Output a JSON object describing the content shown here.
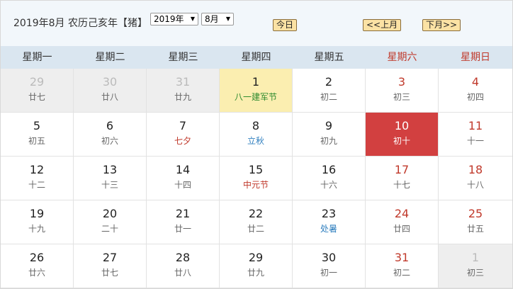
{
  "header": {
    "title": "2019年8月 农历己亥年【猪】",
    "year_select": "2019年",
    "month_select": "8月",
    "today_button": "今日",
    "prev_button": "<<上月",
    "next_button": "下月>>"
  },
  "weekdays": [
    "星期一",
    "星期二",
    "星期三",
    "星期四",
    "星期五",
    "星期六",
    "星期日"
  ],
  "weeks": [
    [
      {
        "day": "29",
        "lunar": "廿七",
        "type": "other"
      },
      {
        "day": "30",
        "lunar": "廿八",
        "type": "other"
      },
      {
        "day": "31",
        "lunar": "廿九",
        "type": "other"
      },
      {
        "day": "1",
        "lunar": "八一建军节",
        "type": "today"
      },
      {
        "day": "2",
        "lunar": "初二",
        "type": "normal"
      },
      {
        "day": "3",
        "lunar": "初三",
        "type": "weekend"
      },
      {
        "day": "4",
        "lunar": "初四",
        "type": "weekend"
      }
    ],
    [
      {
        "day": "5",
        "lunar": "初五",
        "type": "normal"
      },
      {
        "day": "6",
        "lunar": "初六",
        "type": "normal"
      },
      {
        "day": "7",
        "lunar": "七夕",
        "type": "normal",
        "lunar_style": "festival"
      },
      {
        "day": "8",
        "lunar": "立秋",
        "type": "normal",
        "lunar_style": "term"
      },
      {
        "day": "9",
        "lunar": "初九",
        "type": "normal"
      },
      {
        "day": "10",
        "lunar": "初十",
        "type": "selected"
      },
      {
        "day": "11",
        "lunar": "十一",
        "type": "weekend"
      }
    ],
    [
      {
        "day": "12",
        "lunar": "十二",
        "type": "normal"
      },
      {
        "day": "13",
        "lunar": "十三",
        "type": "normal"
      },
      {
        "day": "14",
        "lunar": "十四",
        "type": "normal"
      },
      {
        "day": "15",
        "lunar": "中元节",
        "type": "normal",
        "lunar_style": "festival"
      },
      {
        "day": "16",
        "lunar": "十六",
        "type": "normal"
      },
      {
        "day": "17",
        "lunar": "十七",
        "type": "weekend"
      },
      {
        "day": "18",
        "lunar": "十八",
        "type": "weekend"
      }
    ],
    [
      {
        "day": "19",
        "lunar": "十九",
        "type": "normal"
      },
      {
        "day": "20",
        "lunar": "二十",
        "type": "normal"
      },
      {
        "day": "21",
        "lunar": "廿一",
        "type": "normal"
      },
      {
        "day": "22",
        "lunar": "廿二",
        "type": "normal"
      },
      {
        "day": "23",
        "lunar": "处暑",
        "type": "normal",
        "lunar_style": "term"
      },
      {
        "day": "24",
        "lunar": "廿四",
        "type": "weekend"
      },
      {
        "day": "25",
        "lunar": "廿五",
        "type": "weekend"
      }
    ],
    [
      {
        "day": "26",
        "lunar": "廿六",
        "type": "normal"
      },
      {
        "day": "27",
        "lunar": "廿七",
        "type": "normal"
      },
      {
        "day": "28",
        "lunar": "廿八",
        "type": "normal"
      },
      {
        "day": "29",
        "lunar": "廿九",
        "type": "normal"
      },
      {
        "day": "30",
        "lunar": "初一",
        "type": "normal"
      },
      {
        "day": "31",
        "lunar": "初二",
        "type": "weekend"
      },
      {
        "day": "1",
        "lunar": "初三",
        "type": "other"
      }
    ]
  ]
}
